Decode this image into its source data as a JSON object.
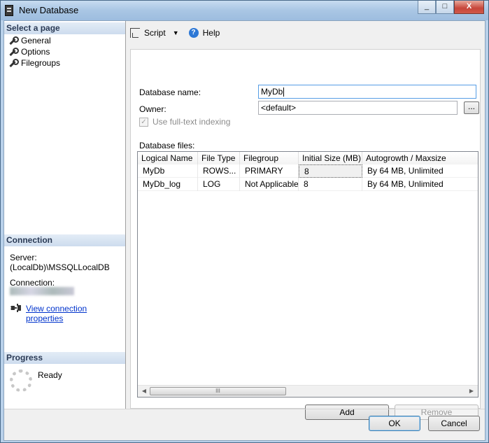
{
  "window": {
    "title": "New Database",
    "caption_buttons": [
      "_",
      "□",
      "X"
    ]
  },
  "left_pane": {
    "select_page_header": "Select a page",
    "pages": [
      {
        "label": "General",
        "icon": "wrench-icon"
      },
      {
        "label": "Options",
        "icon": "wrench-icon"
      },
      {
        "label": "Filegroups",
        "icon": "wrench-icon"
      }
    ],
    "connection_header": "Connection",
    "server_label": "Server:",
    "server_value": "(LocalDb)\\MSSQLLocalDB",
    "connection_label": "Connection:",
    "view_connection_link": "View connection properties",
    "progress_header": "Progress",
    "progress_status": "Ready"
  },
  "toolbar": {
    "script_label": "Script",
    "help_label": "Help"
  },
  "form": {
    "database_name_label": "Database name:",
    "database_name_value": "MyDb",
    "owner_label": "Owner:",
    "owner_value": "<default>",
    "browse_label": "...",
    "fulltext_label": "Use full-text indexing",
    "database_files_label": "Database files:"
  },
  "grid": {
    "columns": [
      "Logical Name",
      "File Type",
      "Filegroup",
      "Initial Size (MB)",
      "Autogrowth / Maxsize"
    ],
    "rows": [
      [
        "MyDb",
        "ROWS...",
        "PRIMARY",
        "8",
        "By 64 MB, Unlimited"
      ],
      [
        "MyDb_log",
        "LOG",
        "Not Applicable",
        "8",
        "By 64 MB, Unlimited"
      ]
    ],
    "scroll_thumb_grip": "III"
  },
  "buttons": {
    "add": "Add",
    "remove": "Remove",
    "ok": "OK",
    "cancel": "Cancel"
  },
  "colors": {
    "link": "#0033cc",
    "section_header_text": "#2a3a55",
    "close_button": "#c7463a"
  }
}
